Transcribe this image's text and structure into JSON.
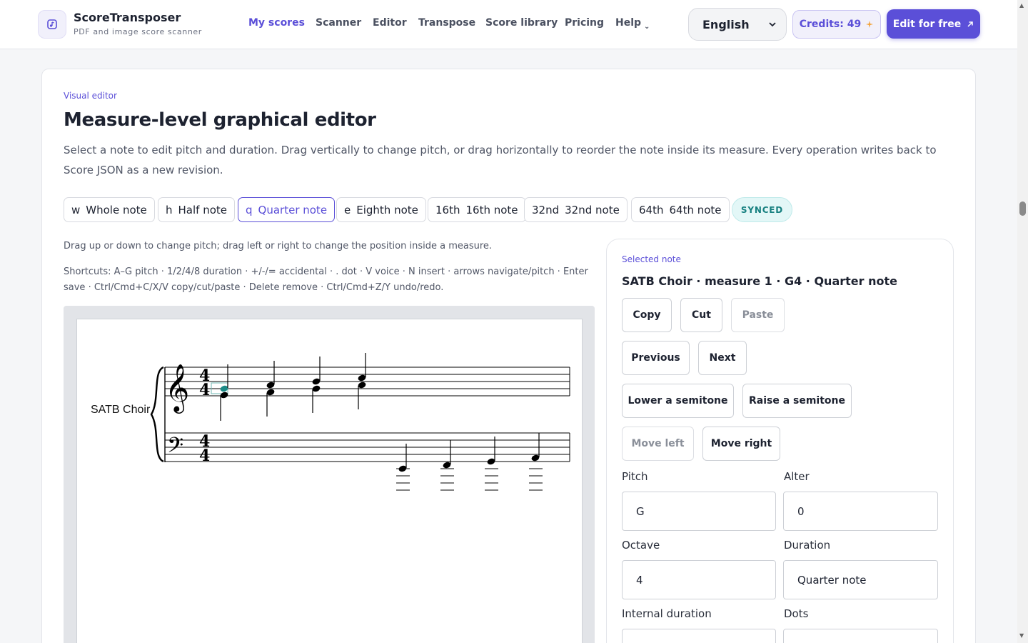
{
  "header": {
    "brand_name": "ScoreTransposer",
    "brand_sub": "PDF and image score scanner",
    "nav": [
      "My scores",
      "Scanner",
      "Editor",
      "Transpose",
      "Score library",
      "Pricing",
      "Help"
    ],
    "language": "English",
    "credits_label": "Credits: 49",
    "edit_free_label": "Edit for free"
  },
  "main": {
    "eyebrow": "Visual editor",
    "title": "Measure-level graphical editor",
    "description": "Select a note to edit pitch and duration. Drag vertically to change pitch, or drag horizontally to reorder the note inside its measure. Every operation writes back to Score JSON as a new revision.",
    "durations": [
      {
        "key": "w",
        "label": "Whole note"
      },
      {
        "key": "h",
        "label": "Half note"
      },
      {
        "key": "q",
        "label": "Quarter note"
      },
      {
        "key": "e",
        "label": "Eighth note"
      },
      {
        "key": "16th",
        "label": "16th note"
      },
      {
        "key": "32nd",
        "label": "32nd note"
      },
      {
        "key": "64th",
        "label": "64th note"
      }
    ],
    "status_badge": "SYNCED",
    "hint": "Drag up or down to change pitch; drag left or right to change the position inside a measure.",
    "shortcuts": "Shortcuts: A–G pitch · 1/2/4/8 duration · +/-/= accidental · . dot · V voice · N insert · arrows navigate/pitch · Enter save · Ctrl/Cmd+C/X/V copy/cut/paste · Delete remove · Ctrl/Cmd+Z/Y undo/redo.",
    "part_name": "SATB Choir"
  },
  "panel": {
    "eyebrow": "Selected note",
    "title": "SATB Choir · measure 1 · G4 · Quarter note",
    "buttons": {
      "copy": "Copy",
      "cut": "Cut",
      "paste": "Paste",
      "previous": "Previous",
      "next": "Next",
      "lower": "Lower a semitone",
      "raise": "Raise a semitone",
      "move_left": "Move left",
      "move_right": "Move right"
    },
    "fields": {
      "pitch_label": "Pitch",
      "pitch_value": "G",
      "alter_label": "Alter",
      "alter_value": "0",
      "octave_label": "Octave",
      "octave_value": "4",
      "duration_label": "Duration",
      "duration_value": "Quarter note",
      "internal_duration_label": "Internal duration",
      "dots_label": "Dots"
    }
  },
  "colors": {
    "accent": "#5b4fd8",
    "selected_note": "#1a8a86",
    "synced_bg": "#e3f7f7"
  }
}
